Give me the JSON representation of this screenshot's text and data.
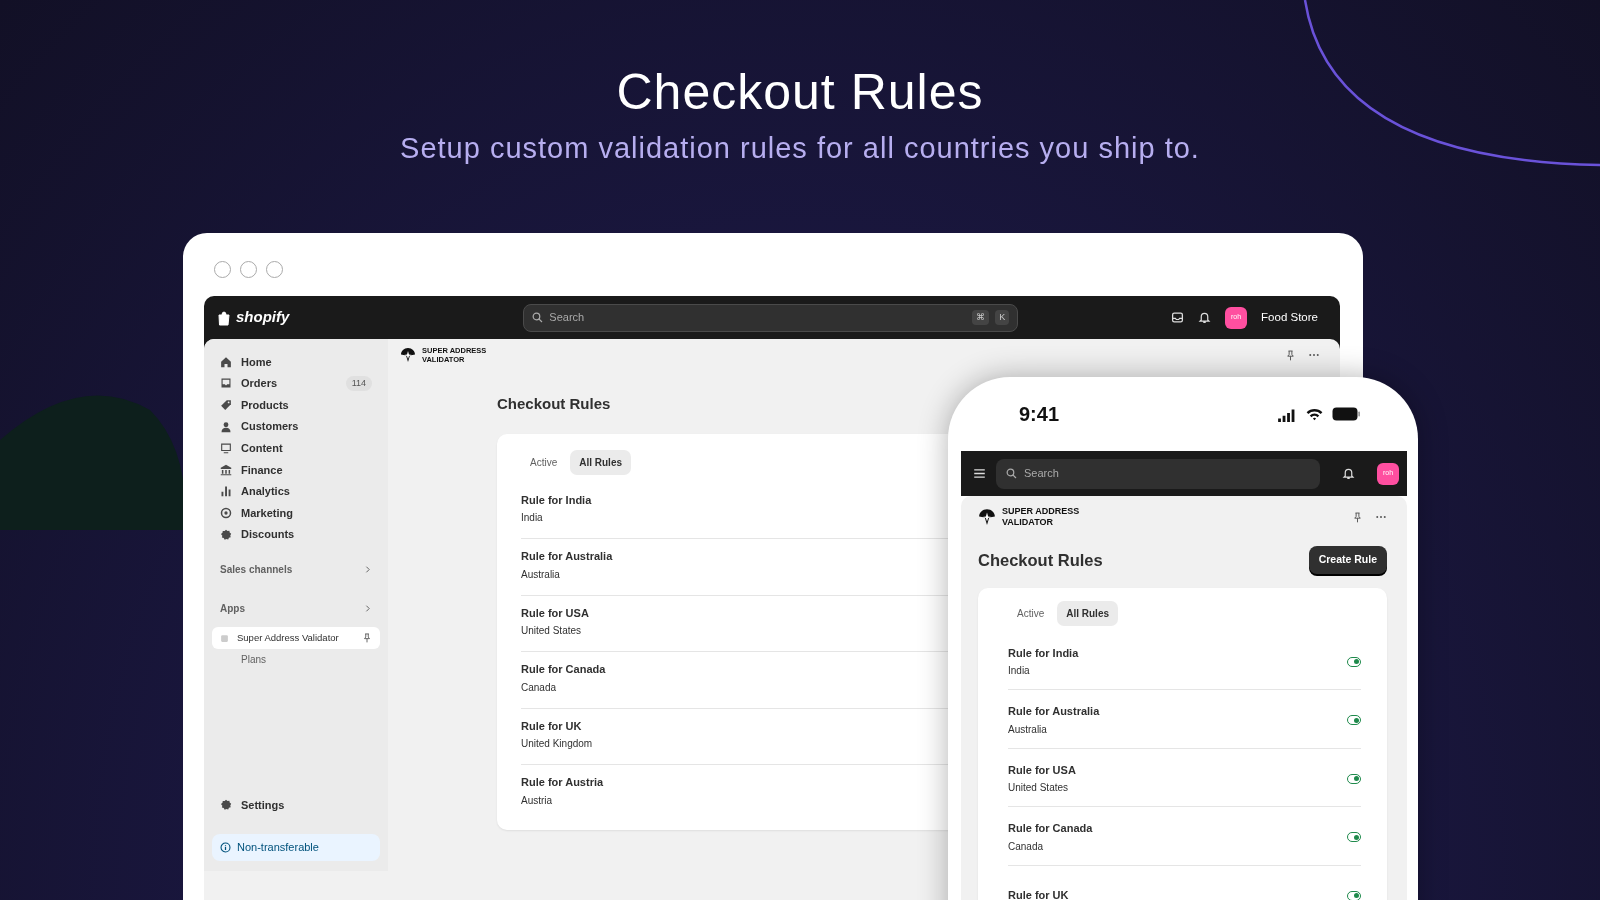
{
  "hero": {
    "title": "Checkout Rules",
    "subtitle": "Setup custom validation rules for all countries you ship to."
  },
  "desktop": {
    "topbar": {
      "logo": "shopify",
      "search": {
        "placeholder": "Search",
        "keys": [
          "⌘",
          "K"
        ]
      },
      "avatar": "roh",
      "store": "Food Store"
    },
    "sidebar": {
      "items": [
        {
          "label": "Home",
          "selected": false
        },
        {
          "label": "Orders",
          "badge": "114",
          "selected": false
        },
        {
          "label": "Products",
          "selected": false
        },
        {
          "label": "Customers",
          "selected": false
        },
        {
          "label": "Content",
          "selected": false
        },
        {
          "label": "Finance",
          "selected": false
        },
        {
          "label": "Analytics",
          "selected": false
        },
        {
          "label": "Marketing",
          "selected": false
        },
        {
          "label": "Discounts",
          "selected": false
        }
      ],
      "groups": [
        {
          "label": "Sales channels"
        },
        {
          "label": "Apps"
        }
      ],
      "app": {
        "label": "Super Address Validator",
        "selected": true,
        "children": [
          {
            "label": "Plans",
            "selected": false
          }
        ]
      },
      "settings": "Settings",
      "notice": "Non-transferable"
    },
    "app_header": "SUPER ADDRESS VALIDATOR",
    "page_title": "Checkout Rules",
    "tabs": [
      {
        "label": "Active",
        "selected": false
      },
      {
        "label": "All Rules",
        "selected": true
      }
    ],
    "rules": [
      {
        "name": "Rule for India",
        "country": "India"
      },
      {
        "name": "Rule for Australia",
        "country": "Australia"
      },
      {
        "name": "Rule for USA",
        "country": "United States"
      },
      {
        "name": "Rule for Canada",
        "country": "Canada"
      },
      {
        "name": "Rule for UK",
        "country": "United Kingdom"
      },
      {
        "name": "Rule for Austria",
        "country": "Austria"
      }
    ]
  },
  "phone": {
    "time": "9:41",
    "search": {
      "placeholder": "Search"
    },
    "avatar": "roh",
    "app_header": "SUPER ADDRESS VALIDATOR",
    "page_title": "Checkout Rules",
    "button": "Create Rule",
    "tabs": [
      {
        "label": "Active",
        "selected": false
      },
      {
        "label": "All Rules",
        "selected": true
      }
    ],
    "rules": [
      {
        "name": "Rule for India",
        "country": "India",
        "on": true
      },
      {
        "name": "Rule for Australia",
        "country": "Australia",
        "on": true
      },
      {
        "name": "Rule for USA",
        "country": "United States",
        "on": true
      },
      {
        "name": "Rule for Canada",
        "country": "Canada",
        "on": true
      },
      {
        "name": "Rule for UK",
        "on": true
      }
    ]
  }
}
